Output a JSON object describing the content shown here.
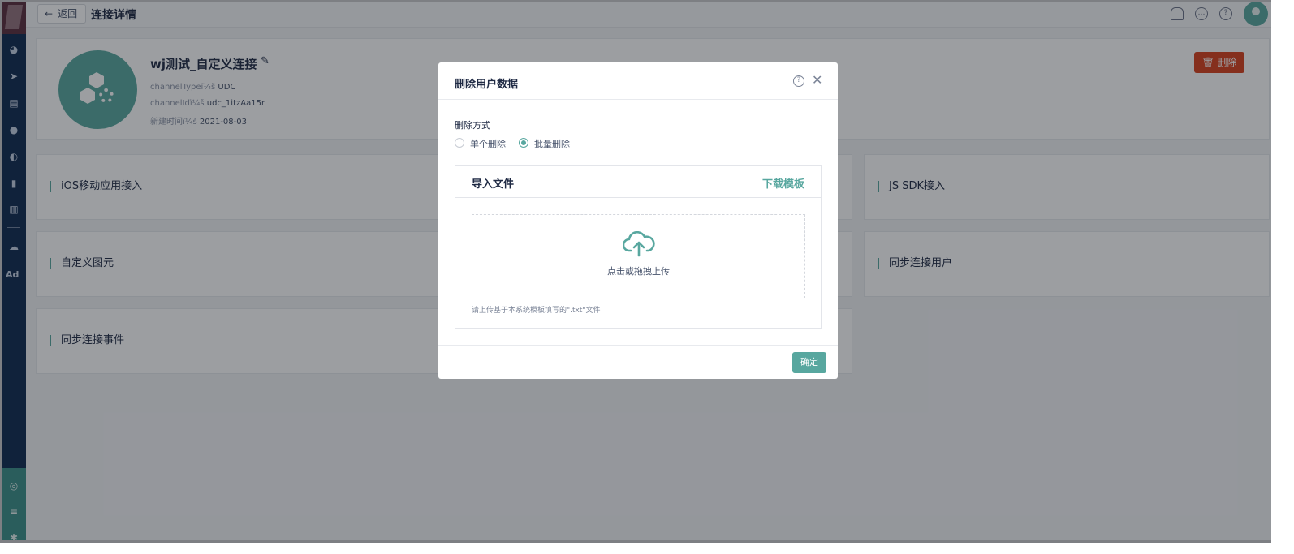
{
  "topbar": {
    "back_label": "返回",
    "page_title": "连接详情"
  },
  "channel": {
    "name": "wj测试_自定义连接",
    "type_label": "channelTypeï¼š",
    "type_value": "UDC",
    "id_label": "channelIdï¼š",
    "id_value": "udc_1itzAa15r",
    "created_label": "新建时间ï¼š",
    "created_value": "2021-08-03",
    "delete_label": "删除"
  },
  "tiles": [
    {
      "title": "iOS移动应用接入"
    },
    {
      "title": "JS SDK接入"
    },
    {
      "title": "自定义图元"
    },
    {
      "title": "同步连接用户"
    },
    {
      "title": "同步连接事件"
    }
  ],
  "sidebar": {
    "ad_label": "Ad"
  },
  "modal": {
    "title": "删除用户数据",
    "method_label": "删除方式",
    "options": [
      {
        "label": "单个删除",
        "selected": false
      },
      {
        "label": "批量删除",
        "selected": true
      }
    ],
    "import_title": "导入文件",
    "download_link": "下载模板",
    "drop_text": "点击或拖拽上传",
    "hint": "请上传基于本系统模板填写的\".txt\"文件",
    "confirm_label": "确定"
  },
  "colors": {
    "accent": "#58a79f",
    "danger": "#d8401c",
    "sidebar": "#0e2a50"
  }
}
